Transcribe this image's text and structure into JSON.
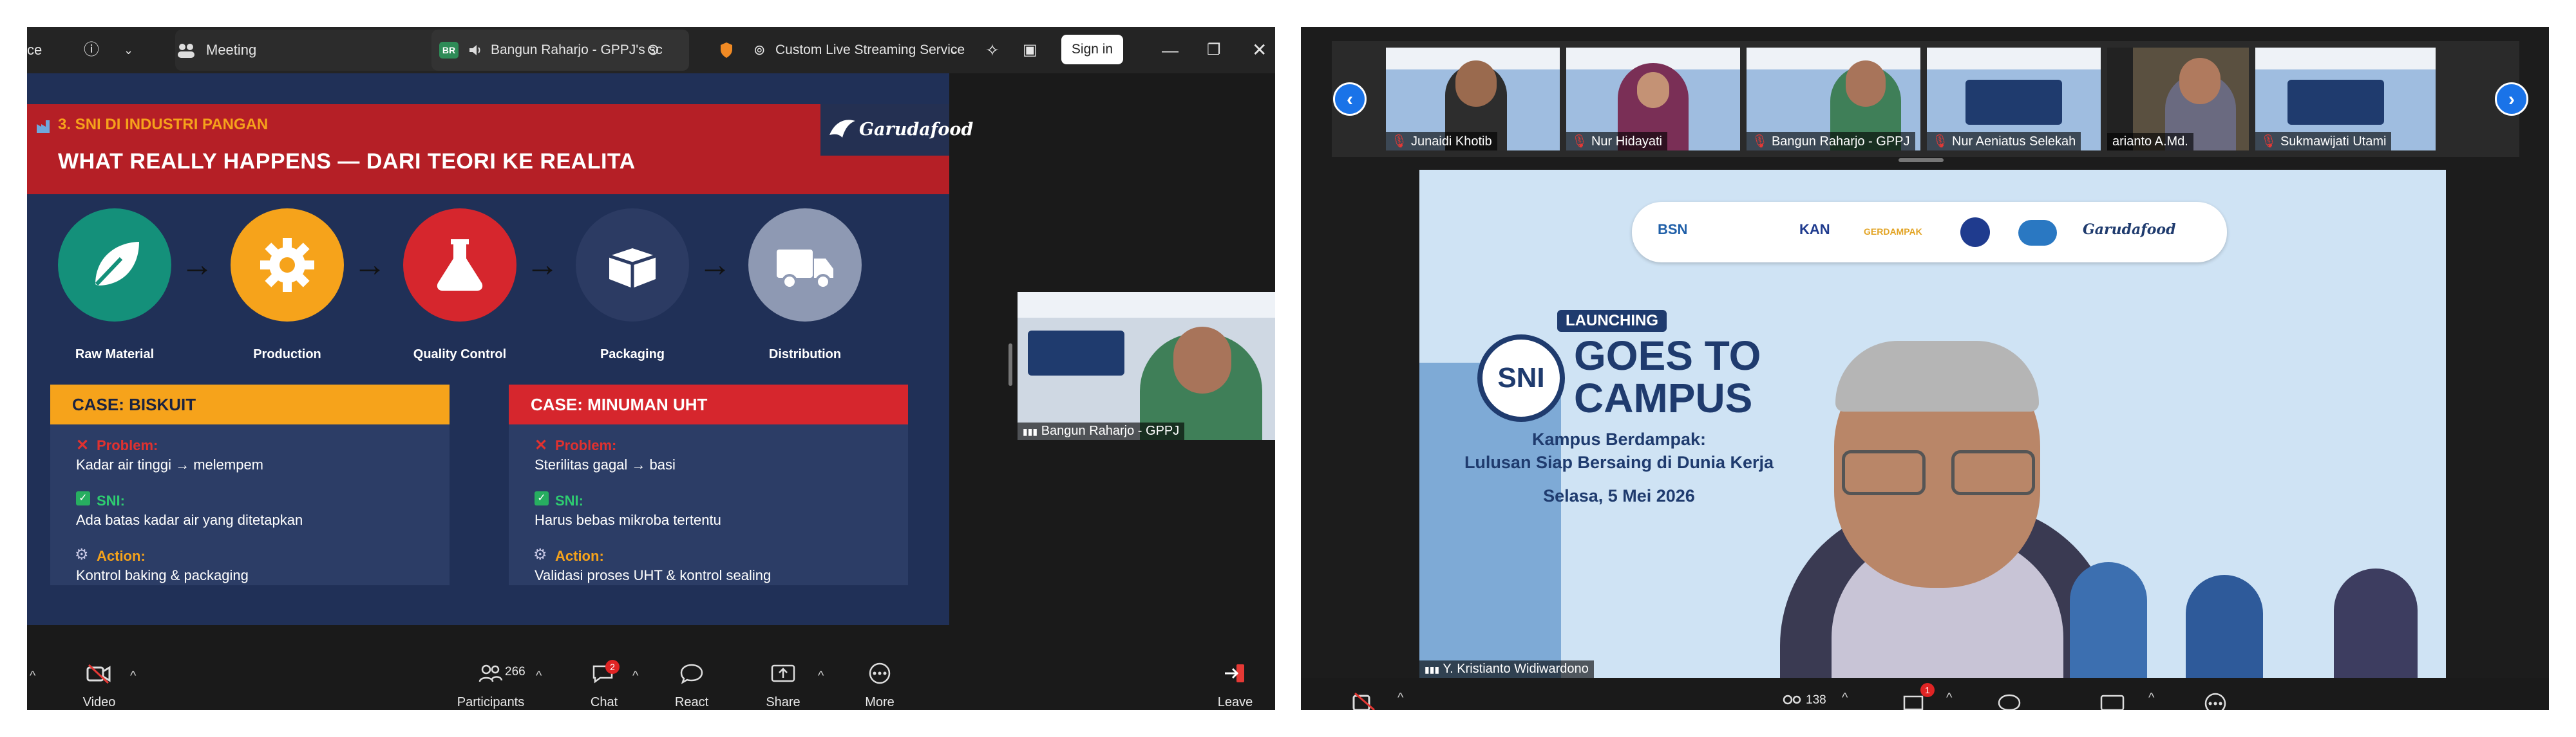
{
  "left_window": {
    "titlebar": {
      "ce": "ce",
      "meeting_label": "Meeting",
      "user_badge": "BR",
      "shared_tab_label": "Bangun Raharjo - GPPJ's sc",
      "live_label": "Custom Live Streaming Service",
      "sign_in": "Sign in"
    },
    "slide": {
      "section_tag": "3. SNI DI INDUSTRI PANGAN",
      "title": "WHAT REALLY HAPPENS — DARI TEORI KE REALITA",
      "logo_text": "Garudafood",
      "steps": [
        {
          "label": "Raw Material",
          "color": "#14907a"
        },
        {
          "label": "Production",
          "color": "#f6a31b"
        },
        {
          "label": "Quality Control",
          "color": "#d6262d"
        },
        {
          "label": "Packaging",
          "color": "#2c3b63"
        },
        {
          "label": "Distribution",
          "color": "#8e99b3"
        }
      ],
      "cases": [
        {
          "title": "CASE: BISKUIT",
          "head_color": "#f6a31b",
          "problem_label": "Problem:",
          "problem": "Kadar air tinggi → melempem",
          "sni_label": "SNI:",
          "sni": "Ada batas kadar air yang ditetapkan",
          "action_label": "Action:",
          "action": "Kontrol baking & packaging"
        },
        {
          "title": "CASE: MINUMAN UHT",
          "head_color": "#d6262d",
          "problem_label": "Problem:",
          "problem": "Sterilitas gagal → basi",
          "sni_label": "SNI:",
          "sni": "Harus bebas mikroba tertentu",
          "action_label": "Action:",
          "action": "Validasi proses UHT & kontrol sealing"
        }
      ]
    },
    "self_view_name": "Bangun Raharjo - GPPJ",
    "toolbar": {
      "video": "Video",
      "participants": "Participants",
      "participants_count": "266",
      "chat": "Chat",
      "chat_badge": "2",
      "react": "React",
      "share": "Share",
      "more": "More",
      "leave": "Leave"
    }
  },
  "right_window": {
    "participants": [
      {
        "name": "Junaidi Khotib"
      },
      {
        "name": "Nur Hidayati"
      },
      {
        "name": "Bangun Raharjo - GPPJ"
      },
      {
        "name": "Nur Aeniatus Selekah"
      },
      {
        "name": "arianto A.Md."
      },
      {
        "name": "Sukmawijati Utami"
      }
    ],
    "speaker": {
      "logos": [
        "BSN",
        "KAN",
        "GERDAMPAK",
        "Garudafood"
      ],
      "launching": "LAUNCHING",
      "sni": "SNI",
      "goes_to": "GOES TO",
      "campus": "CAMPUS",
      "subtitle_1": "Kampus Berdampak:",
      "subtitle_2": "Lulusan Siap Bersaing di Dunia Kerja",
      "date": "Selasa, 5 Mei 2026",
      "name": "Y. Kristianto Widiwardono"
    },
    "toolbar": {
      "participants_count": "138",
      "chat_badge": "1"
    }
  }
}
